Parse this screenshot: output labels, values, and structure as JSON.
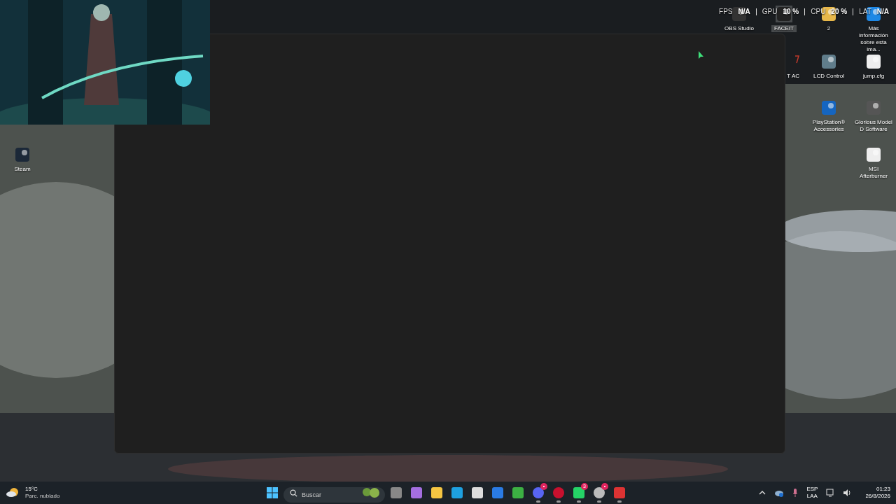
{
  "overlay": [
    {
      "label": "FPS",
      "value": "N/A"
    },
    {
      "label": "GPU",
      "value": "10 %"
    },
    {
      "label": "CPU",
      "value": "20 %"
    },
    {
      "label": "LAT",
      "value": "N/A"
    }
  ],
  "desktop_icons": [
    {
      "label": "Steam",
      "selected": false
    },
    {
      "label": "OBS Studio",
      "selected": false
    },
    {
      "label": "FACEIT",
      "selected": true
    },
    {
      "label": "2",
      "selected": false
    },
    {
      "label": "Más información sobre esta ima...",
      "selected": false
    },
    {
      "label": "T AC",
      "selected": false
    },
    {
      "label": "LCD Control",
      "selected": false
    },
    {
      "label": "jump.cfg",
      "selected": false
    },
    {
      "label": "PlayStation® Accessories",
      "selected": false
    },
    {
      "label": "Glorious Model D Software",
      "selected": false
    },
    {
      "label": "MSI Afterburner",
      "selected": false
    }
  ],
  "taskbar": {
    "weather": {
      "temperature": "15°C",
      "condition": "Parc. nublado"
    },
    "search": {
      "placeholder": "Buscar"
    },
    "apps": [
      {
        "running": false
      },
      {
        "running": false
      },
      {
        "running": false
      },
      {
        "running": false
      },
      {
        "running": false
      },
      {
        "running": false
      },
      {
        "running": false
      },
      {
        "running": true,
        "badge": "•"
      },
      {
        "running": true
      },
      {
        "running": true,
        "badge": "3"
      },
      {
        "running": true,
        "badge": "•"
      },
      {
        "running": true
      }
    ],
    "tray": {
      "language": "ESP",
      "layout": "LAA",
      "time": "01:23",
      "date": "26/8/2026"
    }
  }
}
